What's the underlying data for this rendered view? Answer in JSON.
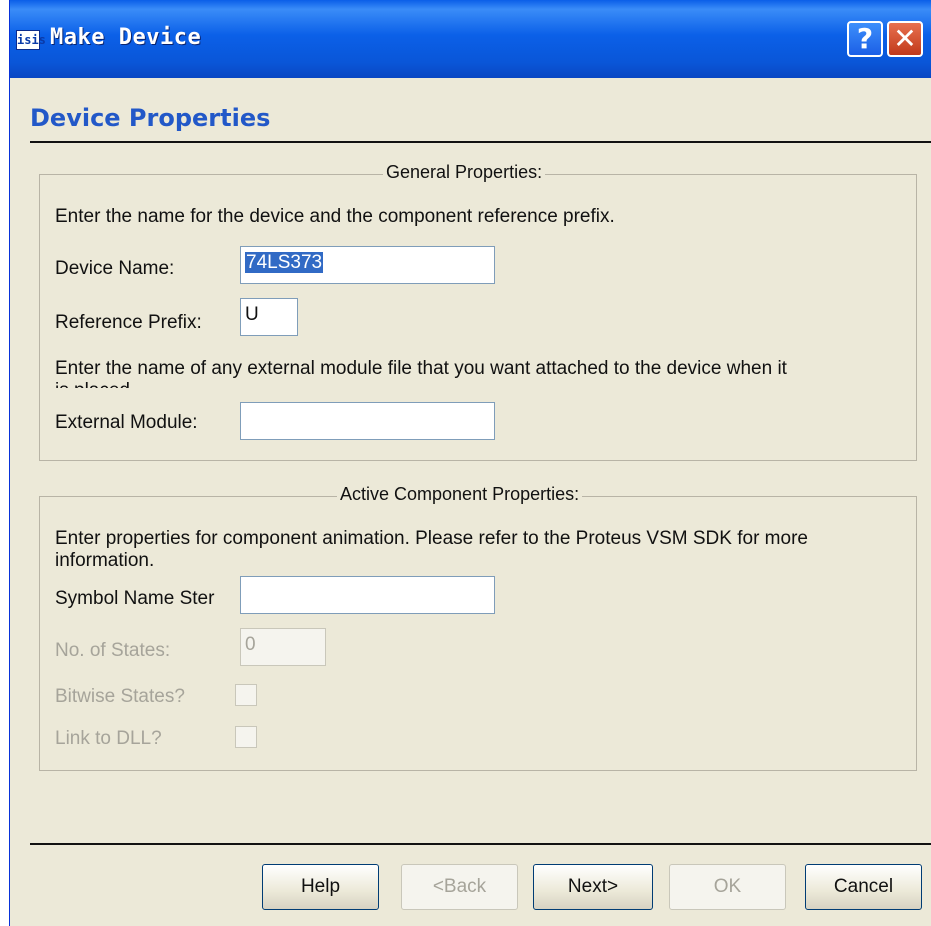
{
  "window": {
    "icon_text": "isis",
    "title": "Make Device",
    "help_glyph": "?",
    "close_glyph": "✕"
  },
  "page": {
    "title": "Device Properties"
  },
  "general": {
    "legend": "General Properties:",
    "intro": "Enter the name for the device and the component reference prefix.",
    "device_name_label": "Device Name:",
    "device_name_value": "74LS373",
    "ref_prefix_label": "Reference Prefix:",
    "ref_prefix_value": "U",
    "module_intro_line1": "Enter the name of any external module file that you want attached to the device when it",
    "module_intro_line2": "is placed.",
    "external_module_label": "External Module:",
    "external_module_value": ""
  },
  "active": {
    "legend": "Active Component Properties:",
    "intro_line1": "Enter properties for component animation. Please refer to the Proteus VSM SDK for more",
    "intro_line2": "information.",
    "symbol_stem_label": "Symbol Name Ster",
    "symbol_stem_value": "",
    "states_label": "No. of States:",
    "states_value": "0",
    "bitwise_label": "Bitwise States?",
    "link_dll_label": "Link to DLL?"
  },
  "buttons": {
    "help": "Help",
    "back": "<Back",
    "next": "Next>",
    "ok": "OK",
    "cancel": "Cancel"
  }
}
